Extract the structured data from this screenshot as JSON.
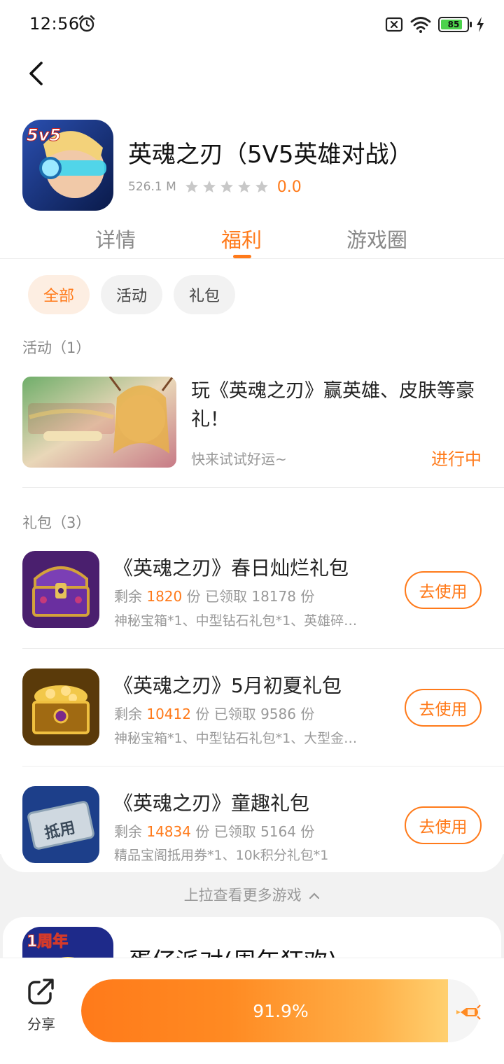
{
  "status_bar": {
    "time": "12:56",
    "battery": "85"
  },
  "app": {
    "title": "英魂之刃（5V5英雄对战）",
    "size": "526.1 M",
    "rating": "0.0"
  },
  "tabs": [
    {
      "label": "详情"
    },
    {
      "label": "福利"
    },
    {
      "label": "游戏圈"
    }
  ],
  "filters": [
    {
      "label": "全部"
    },
    {
      "label": "活动"
    },
    {
      "label": "礼包"
    }
  ],
  "activities": {
    "section_title": "活动（1）",
    "items": [
      {
        "title": "玩《英魂之刃》赢英雄、皮肤等豪礼！",
        "desc": "快来试试好运~",
        "status": "进行中"
      }
    ]
  },
  "gifts": {
    "section_title": "礼包（3）",
    "remaining_prefix": "剩余",
    "claimed_prefix": "份 已领取",
    "unit": "份",
    "use_label": "去使用",
    "items": [
      {
        "title": "《英魂之刃》春日灿烂礼包",
        "remaining": "1820",
        "claimed": "18178",
        "desc": "神秘宝箱*1、中型钻石礼包*1、英雄碎…"
      },
      {
        "title": "《英魂之刃》5月初夏礼包",
        "remaining": "10412",
        "claimed": "9586",
        "desc": "神秘宝箱*1、中型钻石礼包*1、大型金…"
      },
      {
        "title": "《英魂之刃》童趣礼包",
        "remaining": "14834",
        "claimed": "5164",
        "desc": "精品宝阁抵用券*1、10k积分礼包*1"
      }
    ]
  },
  "pull_more": "上拉查看更多游戏",
  "next_game": {
    "title": "蛋仔派对(周年狂欢)"
  },
  "bottom": {
    "share_label": "分享",
    "progress_text": "91.9%",
    "progress_value": 0.919
  },
  "colors": {
    "accent": "#ff7a1a",
    "chip_active_bg": "#fdeee2"
  }
}
